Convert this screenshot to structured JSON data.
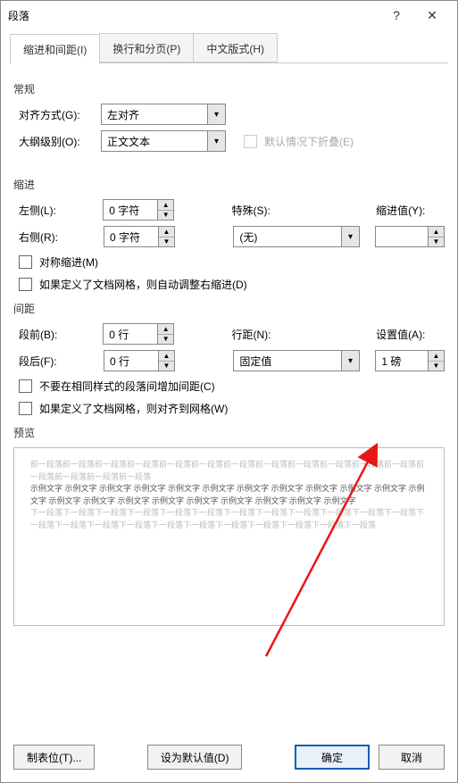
{
  "titlebar": {
    "title": "段落",
    "help": "?",
    "close": "✕"
  },
  "tabs": {
    "t1": "缩进和间距(I)",
    "t2": "换行和分页(P)",
    "t3": "中文版式(H)"
  },
  "general": {
    "title": "常规",
    "align_label": "对齐方式(G):",
    "align_value": "左对齐",
    "outline_label": "大纲级别(O):",
    "outline_value": "正文文本",
    "collapse_label": "默认情况下折叠(E)"
  },
  "indent": {
    "title": "缩进",
    "left_label": "左侧(L):",
    "left_value": "0 字符",
    "right_label": "右侧(R):",
    "right_value": "0 字符",
    "special_label": "特殊(S):",
    "special_value": "(无)",
    "by_label": "缩进值(Y):",
    "mirror_label": "对称缩进(M)",
    "autogrid_label": "如果定义了文档网格，则自动调整右缩进(D)"
  },
  "spacing": {
    "title": "间距",
    "before_label": "段前(B):",
    "before_value": "0 行",
    "after_label": "段后(F):",
    "after_value": "0 行",
    "line_label": "行距(N):",
    "line_value": "固定值",
    "at_label": "设置值(A):",
    "at_value": "1 磅",
    "noaddsame_label": "不要在相同样式的段落间增加间距(C)",
    "snapgrid_label": "如果定义了文档网格，则对齐到网格(W)"
  },
  "preview": {
    "title": "预览",
    "prev_para": "前一段落前一段落前一段落前一段落前一段落前一段落前一段落前一段落前一段落前一段落前一段落前一段落前一段落前一段落前一段落前一段落",
    "sample": "示例文字 示例文字 示例文字 示例文字 示例文字 示例文字 示例文字 示例文字 示例文字 示例文字 示例文字 示例文字 示例文字 示例文字 示例文字 示例文字 示例文字 示例文字 示例文字 示例文字 示例文字",
    "next_para": "下一段落下一段落下一段落下一段落下一段落下一段落下一段落下一段落下一段落下一段落下一段落下一段落下一段落下一段落下一段落下一段落下一段落下一段落下一段落下一段落下一段落下一段落下一段落"
  },
  "footer": {
    "tabs": "制表位(T)...",
    "default": "设为默认值(D)",
    "ok": "确定",
    "cancel": "取消"
  }
}
